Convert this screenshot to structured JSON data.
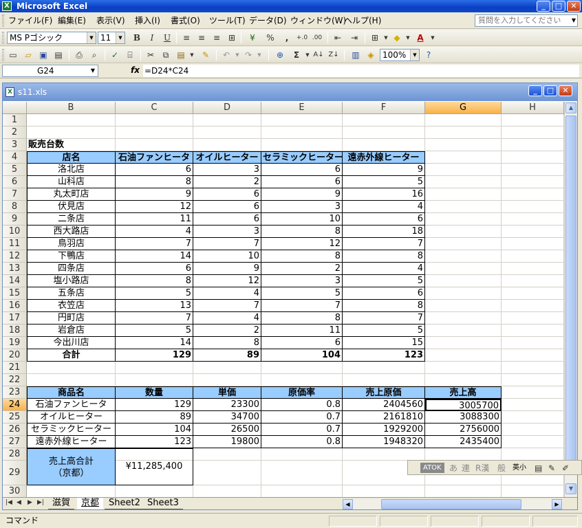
{
  "app": {
    "title": "Microsoft Excel"
  },
  "menu": {
    "items": [
      "ファイル(F)",
      "編集(E)",
      "表示(V)",
      "挿入(I)",
      "書式(O)",
      "ツール(T)",
      "データ(D)",
      "ウィンドウ(W)",
      "ヘルプ(H)"
    ],
    "help_placeholder": "質問を入力してください"
  },
  "toolbar": {
    "font_name": "MS Pゴシック",
    "font_size": "11",
    "zoom": "100%",
    "bold": "B",
    "italic": "I",
    "underline": "U",
    "percent": "%",
    "comma": ",",
    "sigma": "Σ",
    "font_color_glyph": "A"
  },
  "formula_bar": {
    "name_box": "G24",
    "fx": "fx",
    "formula": "=D24*C24"
  },
  "workbook": {
    "filename": "s11.xls"
  },
  "columns": [
    "B",
    "C",
    "D",
    "E",
    "F",
    "G",
    "H"
  ],
  "selected_column": "G",
  "selected_row": "24",
  "rows": [
    "1",
    "2",
    "3",
    "4",
    "5",
    "6",
    "7",
    "8",
    "9",
    "10",
    "11",
    "12",
    "13",
    "14",
    "15",
    "16",
    "17",
    "18",
    "19",
    "20",
    "21",
    "22",
    "23",
    "24",
    "25",
    "26",
    "27",
    "28",
    "29",
    "30"
  ],
  "table1": {
    "title": "販売台数",
    "headers": [
      "店名",
      "石油ファンヒータ",
      "オイルヒーター",
      "セラミックヒーター",
      "遠赤外線ヒーター"
    ],
    "rows": [
      [
        "洛北店",
        "6",
        "3",
        "6",
        "9"
      ],
      [
        "山科店",
        "8",
        "2",
        "6",
        "5"
      ],
      [
        "丸太町店",
        "9",
        "6",
        "9",
        "16"
      ],
      [
        "伏見店",
        "12",
        "6",
        "3",
        "4"
      ],
      [
        "二条店",
        "11",
        "6",
        "10",
        "6"
      ],
      [
        "西大路店",
        "4",
        "3",
        "8",
        "18"
      ],
      [
        "鳥羽店",
        "7",
        "7",
        "12",
        "7"
      ],
      [
        "下鴨店",
        "14",
        "10",
        "8",
        "8"
      ],
      [
        "四条店",
        "6",
        "9",
        "2",
        "4"
      ],
      [
        "塩小路店",
        "8",
        "12",
        "3",
        "5"
      ],
      [
        "五条店",
        "5",
        "4",
        "5",
        "6"
      ],
      [
        "衣笠店",
        "13",
        "7",
        "7",
        "8"
      ],
      [
        "円町店",
        "7",
        "4",
        "8",
        "7"
      ],
      [
        "岩倉店",
        "5",
        "2",
        "11",
        "5"
      ],
      [
        "今出川店",
        "14",
        "8",
        "6",
        "15"
      ]
    ],
    "total": [
      "合計",
      "129",
      "89",
      "104",
      "123"
    ]
  },
  "table2": {
    "headers": [
      "商品名",
      "数量",
      "単価",
      "原価率",
      "売上原価",
      "売上高"
    ],
    "rows": [
      [
        "石油ファンヒータ",
        "129",
        "23300",
        "0.8",
        "2404560",
        "3005700"
      ],
      [
        "オイルヒーター",
        "89",
        "34700",
        "0.7",
        "2161810",
        "3088300"
      ],
      [
        "セラミックヒーター",
        "104",
        "26500",
        "0.7",
        "1929200",
        "2756000"
      ],
      [
        "遠赤外線ヒーター",
        "123",
        "19800",
        "0.8",
        "1948320",
        "2435400"
      ]
    ]
  },
  "summary": {
    "label_line1": "売上高合計",
    "label_line2": "（京都）",
    "value": "¥11,285,400"
  },
  "sheets": [
    "滋賀",
    "京都",
    "Sheet2",
    "Sheet3"
  ],
  "active_sheet": "京都",
  "status": {
    "mode": "コマンド"
  },
  "atok": {
    "label": "ATOK",
    "items": [
      "あ",
      "連",
      "R漢",
      "般",
      "英小"
    ]
  }
}
